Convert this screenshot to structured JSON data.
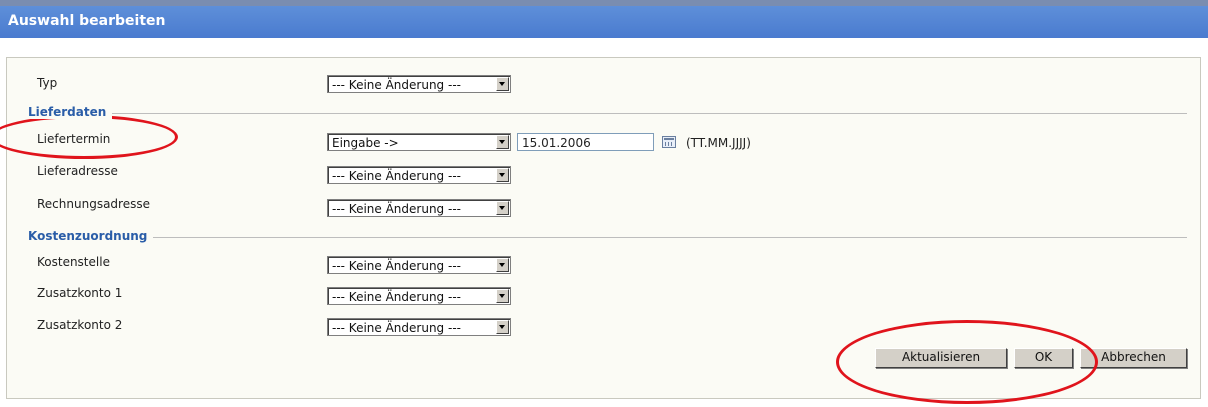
{
  "window": {
    "title": "Auswahl bearbeiten"
  },
  "form": {
    "typ": {
      "label": "Typ",
      "value": "--- Keine Änderung ---"
    },
    "lieferdaten": {
      "section_title": "Lieferdaten",
      "liefertermin": {
        "label": "Liefertermin",
        "mode": "Eingabe ->",
        "date": "15.01.2006",
        "format_hint": "(TT.MM.JJJJ)"
      },
      "lieferadresse": {
        "label": "Lieferadresse",
        "value": "--- Keine Änderung ---"
      },
      "rechnungsadresse": {
        "label": "Rechnungsadresse",
        "value": "--- Keine Änderung ---"
      }
    },
    "kostenzuordnung": {
      "section_title": "Kostenzuordnung",
      "kostenstelle": {
        "label": "Kostenstelle",
        "value": "--- Keine Änderung ---"
      },
      "zusatzkonto1": {
        "label": "Zusatzkonto 1",
        "value": "--- Keine Änderung ---"
      },
      "zusatzkonto2": {
        "label": "Zusatzkonto 2",
        "value": "--- Keine Änderung ---"
      }
    }
  },
  "buttons": {
    "update": "Aktualisieren",
    "ok": "OK",
    "cancel": "Abbrechen"
  },
  "icons": {
    "calendar": "calendar-icon",
    "dropdown": "chevron-down-icon"
  },
  "colors": {
    "title_bar": "#4a7bcf",
    "section_title": "#2a5da8",
    "annotation": "#e0141c"
  }
}
